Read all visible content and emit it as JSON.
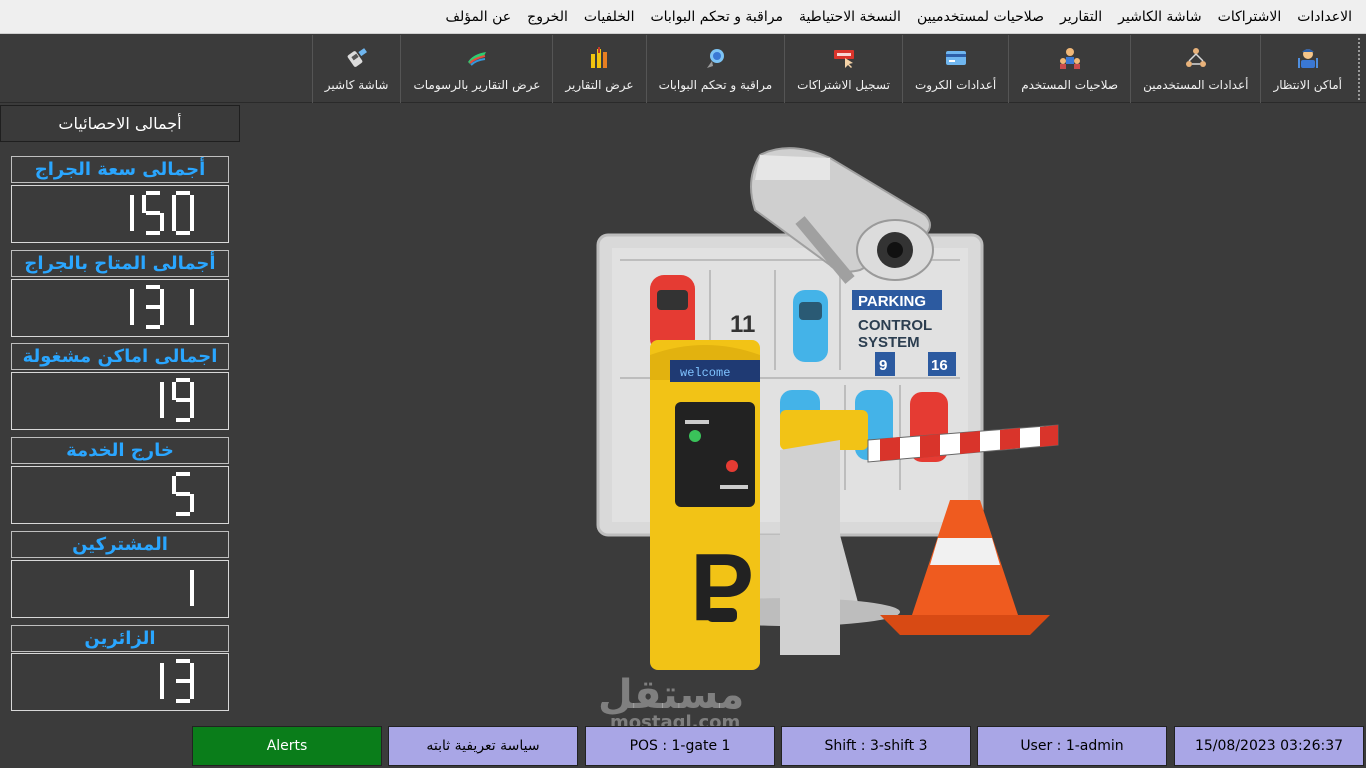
{
  "menu": {
    "items": [
      "الاعدادات",
      "الاشتراكات",
      "شاشة الكاشير",
      "التقارير",
      "صلاحيات لمستخدميين",
      "النسخة الاحتياطية",
      "مراقبة و تحكم البوابات",
      "الخلفيات",
      "الخروج",
      "عن المؤلف"
    ]
  },
  "toolbar": {
    "buttons": [
      {
        "label": "أماكن الانتظار",
        "icon": "parking-attendant-icon"
      },
      {
        "label": "أعدادات المستخدمين",
        "icon": "users-network-icon"
      },
      {
        "label": "صلاحيات المستخدم",
        "icon": "user-permissions-icon"
      },
      {
        "label": "أعدادات الكروت",
        "icon": "card-icon"
      },
      {
        "label": "تسجيل الاشتراكات",
        "icon": "subscribe-icon"
      },
      {
        "label": "مراقبة و تحكم البوابات",
        "icon": "satellite-icon"
      },
      {
        "label": "عرض التقارير",
        "icon": "reports-icon"
      },
      {
        "label": "عرض التقارير بالرسومات",
        "icon": "paint-brush-icon"
      },
      {
        "label": "شاشة كاشير",
        "icon": "card-reader-icon"
      }
    ]
  },
  "stats": {
    "header": "أجمالى الاحصائيات",
    "items": [
      {
        "label": "أجمالى سعة الجراج",
        "value": "150"
      },
      {
        "label": "أجمالى  المتاح بالجراج",
        "value": "131"
      },
      {
        "label": "اجمالى اماكن مشغولة",
        "value": "19"
      },
      {
        "label": "خارج الخدمة",
        "value": "5"
      },
      {
        "label": "المشتركين",
        "value": "1"
      },
      {
        "label": "الزائرين",
        "value": "13"
      }
    ]
  },
  "hero": {
    "sign_line1": "PARKING",
    "sign_line2": "CONTROL",
    "sign_line3": "SYSTEM",
    "spot_a": "11",
    "spot_b": "9",
    "spot_c": "16",
    "kiosk_display": "welcome"
  },
  "watermark": {
    "arabic": "مستقل",
    "latin": "mostaql.com"
  },
  "status": {
    "alerts": "Alerts",
    "policy": "سياسة تعريفية ثابته",
    "pos": "POS : 1-gate 1",
    "shift": "Shift : 3-shift 3",
    "user": "User : 1-admin",
    "datetime": "15/08/2023 03:26:37"
  },
  "colors": {
    "label_blue": "#2aa6ff",
    "alerts_green": "#0a7d1a",
    "status_lavender": "#a9a6e6",
    "background": "#3b3b3b"
  }
}
